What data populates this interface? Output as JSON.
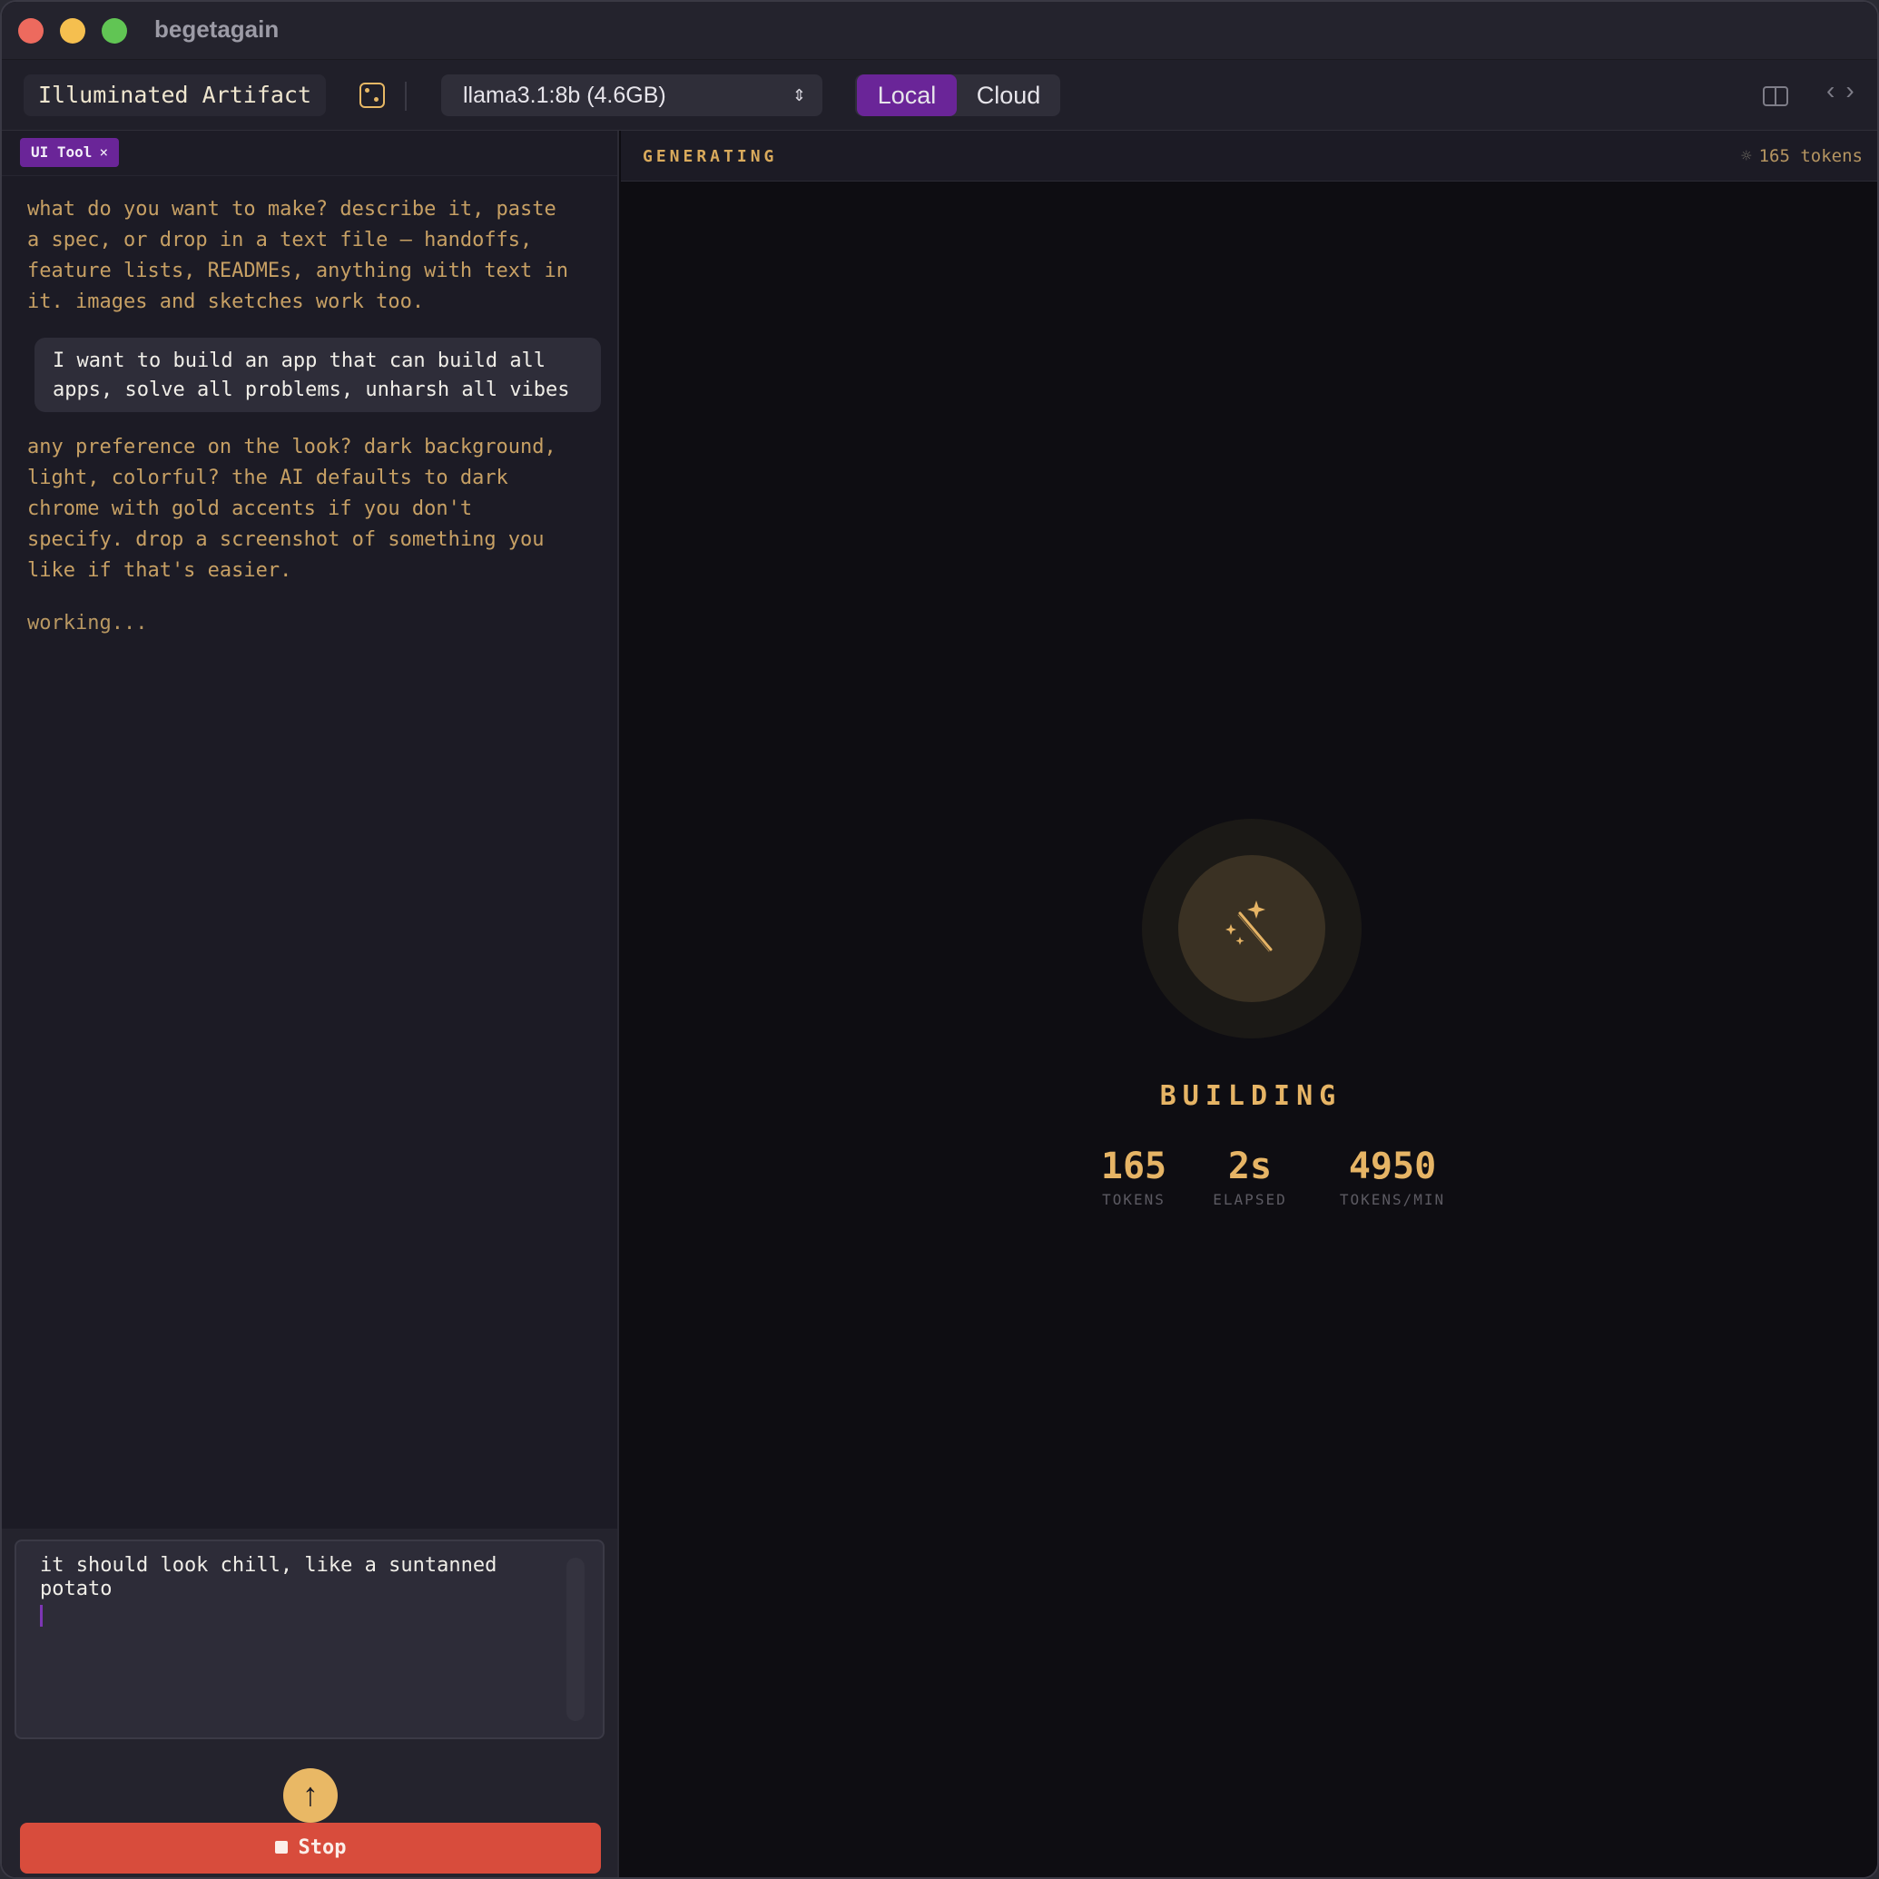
{
  "window": {
    "title": "begetagain"
  },
  "toolbar": {
    "doc_title": "Illuminated Artifact",
    "model": "llama3.1:8b (4.6GB)",
    "mode_local": "Local",
    "mode_cloud": "Cloud",
    "active_mode": "Local",
    "nav_label": "‹ ›"
  },
  "chat": {
    "chip_label": "UI Tool",
    "chip_close": "×",
    "messages": [
      {
        "role": "assistant",
        "text": "what do you want to make? describe it, paste\na spec, or drop in a text file — handoffs,\nfeature lists, READMEs, anything with text in\nit. images and sketches work too."
      },
      {
        "role": "user",
        "text": "I want to build an app that can build all\napps, solve all problems, unharsh all vibes"
      },
      {
        "role": "assistant",
        "text": "any preference on the look? dark background,\nlight, colorful? the AI defaults to dark\nchrome with gold accents if you don't\nspecify. drop a screenshot of something you\nlike if that's easier."
      }
    ],
    "status": "working...",
    "composer_text": "it should look chill, like a suntanned\npotato",
    "send_icon": "↑",
    "stop_label": "Stop"
  },
  "generation": {
    "header": "GENERATING",
    "token_badge": "165 tokens",
    "spinner_glyph": "☼",
    "state": "BUILDING",
    "stats": [
      {
        "value": "165",
        "label": "TOKENS"
      },
      {
        "value": "2s",
        "label": "ELAPSED"
      },
      {
        "value": "4950",
        "label": "TOKENS/MIN"
      }
    ]
  },
  "colors": {
    "accent_gold": "#e6b465",
    "accent_purple": "#6a2598",
    "stop_red": "#d84c3c"
  }
}
